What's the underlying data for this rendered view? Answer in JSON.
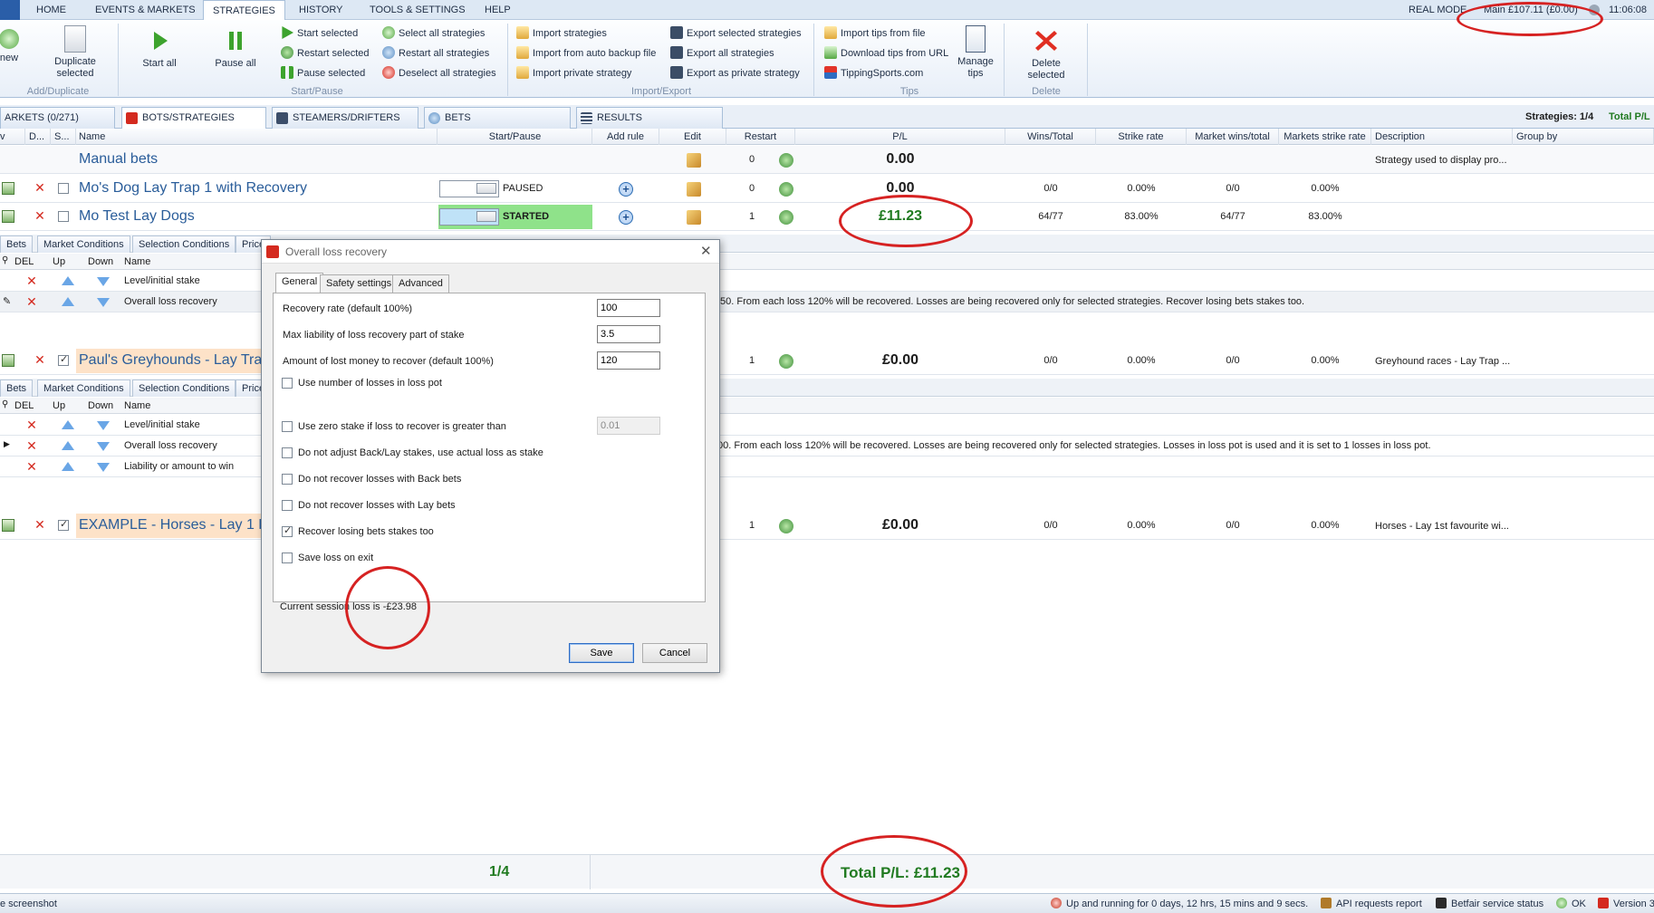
{
  "menu": {
    "tabs": [
      "HOME",
      "EVENTS & MARKETS",
      "STRATEGIES",
      "HISTORY",
      "TOOLS & SETTINGS",
      "HELP"
    ],
    "active": "STRATEGIES",
    "mode": "REAL MODE",
    "balance": "Main £107.11 (£0.00)",
    "time": "11:06:08"
  },
  "ribbon": {
    "new_label": "new",
    "duplicate_label": "Duplicate selected",
    "add_dup_group": "Add/Duplicate",
    "start_all": "Start all",
    "pause_all": "Pause all",
    "start_selected": "Start selected",
    "restart_selected": "Restart selected",
    "pause_selected": "Pause selected",
    "select_all": "Select all strategies",
    "restart_all": "Restart all strategies",
    "deselect_all": "Deselect all strategies",
    "start_pause_group": "Start/Pause",
    "import_strategies": "Import strategies",
    "import_backup": "Import from auto backup file",
    "import_private": "Import private strategy",
    "export_selected": "Export selected strategies",
    "export_all": "Export all strategies",
    "export_private": "Export as private strategy",
    "import_export_group": "Import/Export",
    "import_tips_file": "Import tips from file",
    "download_tips": "Download tips from URL",
    "tipping_sports": "TippingSports.com",
    "manage_tips": "Manage tips",
    "tips_group": "Tips",
    "delete_selected": "Delete selected",
    "delete_group": "Delete"
  },
  "tabs": {
    "markets": "ARKETS (0/271)",
    "bots": "BOTS/STRATEGIES",
    "steamers": "STEAMERS/DRIFTERS",
    "bets": "BETS",
    "results": "RESULTS",
    "strategies_count": "Strategies: 1/4",
    "total_pl_short": "Total P/L"
  },
  "grid": {
    "headers": {
      "v": "v",
      "d": "D...",
      "s": "S...",
      "name": "Name",
      "start_pause": "Start/Pause",
      "add_rule": "Add rule",
      "edit": "Edit",
      "restart": "Restart",
      "pl": "P/L",
      "wins_total": "Wins/Total",
      "strike_rate": "Strike rate",
      "market_wins_total": "Market wins/total",
      "markets_strike_rate": "Markets strike rate",
      "description": "Description",
      "group_by": "Group by"
    },
    "rows": [
      {
        "name": "Manual bets",
        "restart": "0",
        "pl": "0.00",
        "wins_total": "",
        "strike_rate": "",
        "market_wins": "",
        "market_strike": "",
        "description": "Strategy used to display pro..."
      },
      {
        "name": "Mo's Dog Lay Trap 1 with Recovery",
        "state": "PAUSED",
        "restart": "0",
        "pl": "0.00",
        "wins_total": "0/0",
        "strike_rate": "0.00%",
        "market_wins": "0/0",
        "market_strike": "0.00%",
        "description": ""
      },
      {
        "name": "Mo Test Lay Dogs",
        "state": "STARTED",
        "restart": "1",
        "pl": "£11.23",
        "wins_total": "64/77",
        "strike_rate": "83.00%",
        "market_wins": "64/77",
        "market_strike": "83.00%",
        "description": ""
      },
      {
        "name": "Paul's Greyhounds - Lay Trap",
        "restart": "1",
        "pl": "£0.00",
        "wins_total": "0/0",
        "strike_rate": "0.00%",
        "market_wins": "0/0",
        "market_strike": "0.00%",
        "description": "Greyhound races - Lay Trap ..."
      },
      {
        "name": "EXAMPLE - Horses - Lay 1 Fa",
        "restart": "1",
        "pl": "£0.00",
        "wins_total": "0/0",
        "strike_rate": "0.00%",
        "market_wins": "0/0",
        "market_strike": "0.00%",
        "description": "Horses - Lay 1st favourite wi..."
      }
    ]
  },
  "subgrid": {
    "tabs": [
      "Bets",
      "Market Conditions",
      "Selection Conditions",
      "Price"
    ],
    "headers": {
      "del": "DEL",
      "up": "Up",
      "down": "Down",
      "name": "Name"
    },
    "group1": [
      {
        "name": "Level/initial stake",
        "detail": ""
      },
      {
        "name": "Overall loss recovery",
        "detail": ".50. From each loss 120% will be recovered. Losses are being recovered only for selected strategies. Recover losing bets stakes too."
      }
    ],
    "group2": [
      {
        "name": "Level/initial stake",
        "detail": ""
      },
      {
        "name": "Overall loss recovery",
        "detail": "00. From each loss 120% will be recovered. Losses are being recovered only for selected strategies. Losses in loss pot is used and it is set to 1 losses in loss pot."
      },
      {
        "name": "Liability or amount to win",
        "detail": ""
      }
    ]
  },
  "footer": {
    "count": "1/4",
    "total_pl": "Total P/L: £11.23"
  },
  "statusbar": {
    "left": "e screenshot",
    "uptime": "Up and running for 0 days, 12 hrs, 15 mins and 9 secs.",
    "api": "API requests report",
    "betfair": "Betfair service status",
    "ok": "OK",
    "version": "Version 3"
  },
  "dialog": {
    "title": "Overall loss recovery",
    "tabs": [
      "General",
      "Safety settings",
      "Advanced"
    ],
    "recovery_rate_label": "Recovery rate (default 100%)",
    "recovery_rate_value": "100",
    "max_liability_label": "Max liability of loss recovery part of stake",
    "max_liability_value": "3.5",
    "amount_lost_label": "Amount of lost money to recover (default 100%)",
    "amount_lost_value": "120",
    "use_number_losses": "Use number of losses in loss pot",
    "zero_stake_label": "Use zero stake if loss to recover is greater than",
    "zero_stake_value": "0.01",
    "no_adjust": "Do not adjust Back/Lay stakes, use actual loss as stake",
    "no_recover_back": "Do not recover losses with Back bets",
    "no_recover_lay": "Do not recover losses with Lay bets",
    "recover_stakes": "Recover losing bets stakes too",
    "save_loss": "Save loss on exit",
    "session_loss": "Current session loss is -£23.98",
    "save_btn": "Save",
    "cancel_btn": "Cancel"
  },
  "colors": {
    "accent": "#2a5ea8",
    "annotation": "#d62222",
    "profit": "#207a20",
    "started": "#8fe28a",
    "highlight_row": "#fde2c8"
  }
}
